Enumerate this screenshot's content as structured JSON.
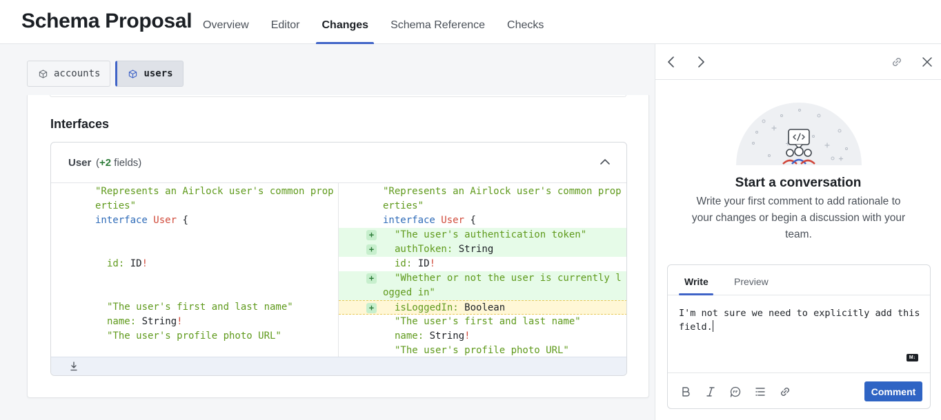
{
  "header": {
    "title": "Schema Proposal",
    "tabs": [
      {
        "label": "Overview",
        "active": false
      },
      {
        "label": "Editor",
        "active": false
      },
      {
        "label": "Changes",
        "active": true
      },
      {
        "label": "Schema Reference",
        "active": false
      },
      {
        "label": "Checks",
        "active": false
      }
    ]
  },
  "subgraphs": [
    {
      "label": "accounts",
      "icon": "cube-icon",
      "active": false
    },
    {
      "label": "users",
      "icon": "cube-icon",
      "active": true
    }
  ],
  "section": {
    "title": "Interfaces"
  },
  "diff": {
    "type_name": "User",
    "count_open": "(",
    "count": "+2",
    "count_suffix": " fields)",
    "left_lines": [
      {
        "indent": 0,
        "parts": [
          {
            "c": "str",
            "t": "\"Represents an Airlock user's common prop"
          }
        ]
      },
      {
        "indent": 0,
        "parts": [
          {
            "c": "str",
            "t": "erties\""
          }
        ]
      },
      {
        "indent": 0,
        "parts": [
          {
            "c": "kw",
            "t": "interface "
          },
          {
            "c": "type",
            "t": "User"
          },
          {
            "c": "plain",
            "t": " {"
          }
        ]
      },
      {
        "indent": 0,
        "parts": []
      },
      {
        "indent": 0,
        "parts": []
      },
      {
        "indent": 1,
        "parts": [
          {
            "c": "field",
            "t": "id: "
          },
          {
            "c": "plain",
            "t": "ID"
          },
          {
            "c": "bang",
            "t": "!"
          }
        ]
      },
      {
        "indent": 0,
        "parts": []
      },
      {
        "indent": 0,
        "parts": []
      },
      {
        "indent": 1,
        "parts": [
          {
            "c": "str",
            "t": "\"The user's first and last name\""
          }
        ]
      },
      {
        "indent": 1,
        "parts": [
          {
            "c": "field",
            "t": "name: "
          },
          {
            "c": "plain",
            "t": "String"
          },
          {
            "c": "bang",
            "t": "!"
          }
        ]
      },
      {
        "indent": 1,
        "parts": [
          {
            "c": "str",
            "t": "\"The user's profile photo URL\""
          }
        ]
      }
    ],
    "right_lines": [
      {
        "indent": 0,
        "kind": "",
        "parts": [
          {
            "c": "str",
            "t": "\"Represents an Airlock user's common prop"
          }
        ]
      },
      {
        "indent": 0,
        "kind": "",
        "parts": [
          {
            "c": "str",
            "t": "erties\""
          }
        ]
      },
      {
        "indent": 0,
        "kind": "",
        "parts": [
          {
            "c": "kw",
            "t": "interface "
          },
          {
            "c": "type",
            "t": "User"
          },
          {
            "c": "plain",
            "t": " {"
          }
        ]
      },
      {
        "indent": 1,
        "kind": "add",
        "parts": [
          {
            "c": "str",
            "t": "\"The user's authentication token\""
          }
        ]
      },
      {
        "indent": 1,
        "kind": "add",
        "parts": [
          {
            "c": "field",
            "t": "authToken: "
          },
          {
            "c": "plain",
            "t": "String"
          }
        ]
      },
      {
        "indent": 1,
        "kind": "",
        "parts": [
          {
            "c": "field",
            "t": "id: "
          },
          {
            "c": "plain",
            "t": "ID"
          },
          {
            "c": "bang",
            "t": "!"
          }
        ]
      },
      {
        "indent": 1,
        "kind": "add",
        "parts": [
          {
            "c": "str",
            "t": "\"Whether or not the user is currently l"
          }
        ]
      },
      {
        "indent": 0,
        "kind": "add-cont",
        "parts": [
          {
            "c": "str",
            "t": "ogged in\""
          }
        ]
      },
      {
        "indent": 1,
        "kind": "add-sel",
        "parts": [
          {
            "c": "field",
            "t": "isLoggedIn: "
          },
          {
            "c": "plain",
            "t": "Boolean"
          }
        ]
      },
      {
        "indent": 1,
        "kind": "",
        "parts": [
          {
            "c": "str",
            "t": "\"The user's first and last name\""
          }
        ]
      },
      {
        "indent": 1,
        "kind": "",
        "parts": [
          {
            "c": "field",
            "t": "name: "
          },
          {
            "c": "plain",
            "t": "String"
          },
          {
            "c": "bang",
            "t": "!"
          }
        ]
      },
      {
        "indent": 1,
        "kind": "",
        "parts": [
          {
            "c": "str",
            "t": "\"The user's profile photo URL\""
          }
        ]
      }
    ],
    "plus_sign": "+"
  },
  "panel": {
    "title": "Start a conversation",
    "description": "Write your first comment to add rationale to your changes or begin a discussion with your team.",
    "composer": {
      "tabs": [
        {
          "label": "Write",
          "active": true
        },
        {
          "label": "Preview",
          "active": false
        }
      ],
      "text": "I'm not sure we need to explicitly add this field.",
      "markdown_badge": "M↓",
      "submit_label": "Comment",
      "tools": [
        "bold-icon",
        "italic-icon",
        "quote-icon",
        "list-icon",
        "link-icon"
      ]
    }
  },
  "colors": {
    "accent": "#3f63c7",
    "button": "#2f64c4",
    "added_bg": "#e6fbe8",
    "selected_bg": "#fff7d6",
    "string": "#5f9a1c",
    "keyword": "#2e6bb8",
    "type": "#d04a3a"
  }
}
